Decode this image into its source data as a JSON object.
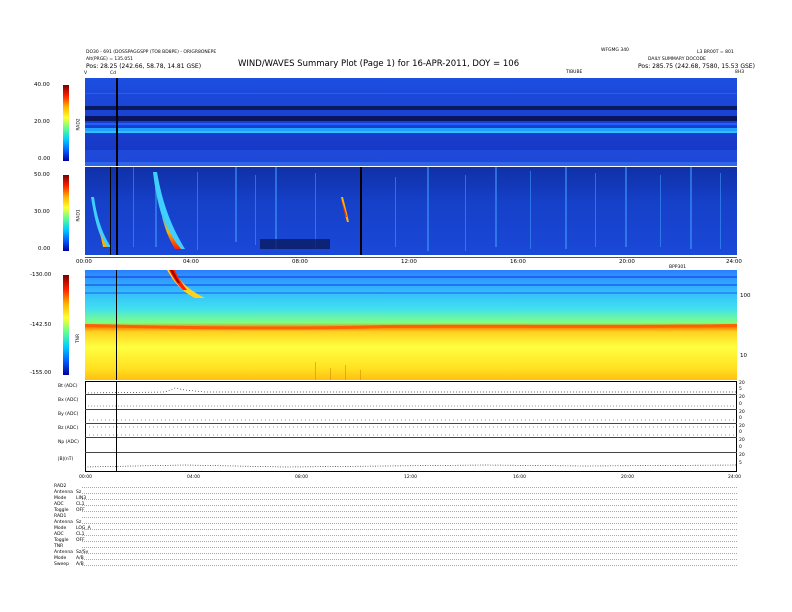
{
  "header": {
    "title": "WIND/WAVES Summary Plot (Page 1) for 16-APR-2011, DOY = 106",
    "top_left_line1": "DO30 - 691 (DOSSPAGGSPP (TO8 BD8PE) - ORIGR8ONEPE",
    "top_left_line2": "Alt(PRGE) = 135.051",
    "top_left_pos": "Pos:  28.25 (242.66, 58.78, 14.81 GSE)",
    "top_right_a": "WFGMG 340",
    "top_right_b": "L3 BR00T = 801",
    "top_right_c": "DAILY SUMMARY DOCODE",
    "top_right_pos": "Pos:  285.75 (242.68, 7580, 15.53 GSE)",
    "top_right_label": "TIBUBE",
    "top_far_right": "8H3"
  },
  "markers": {
    "start": "V",
    "cursor": "Cd"
  },
  "panels": {
    "rad2": {
      "label": "RAD2",
      "ticks": [
        "40.00",
        "20.00",
        "0.00"
      ]
    },
    "rad1": {
      "label": "RAD1",
      "ticks": [
        "50.00",
        "30.00",
        "0.00"
      ]
    },
    "tnr": {
      "label": "TNR",
      "ticks": [
        "-130.00",
        "-142.50",
        "-155.00"
      ],
      "right_ticks": [
        "100",
        "10"
      ],
      "right_tag": "BPP301"
    }
  },
  "time_axis": [
    "00:00",
    "04:00",
    "08:00",
    "12:00",
    "16:00",
    "20:00",
    "24:00"
  ],
  "bottom_axis": [
    "00:00",
    "04:00",
    "08:00",
    "12:00",
    "16:00",
    "20:00",
    "24:00"
  ],
  "traces": [
    {
      "label": "Bt (ADC)",
      "right": [
        "20",
        "5",
        "0"
      ]
    },
    {
      "label": "Bx (ADC)",
      "right": [
        "20",
        "5",
        "0"
      ]
    },
    {
      "label": "By (ADC)",
      "right": [
        "20",
        "5",
        "0"
      ]
    },
    {
      "label": "Bz (ADC)",
      "right": [
        "20",
        "5",
        "0"
      ]
    },
    {
      "label": "Np (ADC)",
      "right": [
        "20",
        "5",
        "0"
      ]
    },
    {
      "label": "|B|(nT)",
      "right": [
        "20",
        "5",
        "0"
      ]
    }
  ],
  "footer": {
    "rad2": {
      "name": "RAD2",
      "rows": [
        [
          "Antenna",
          "Sz"
        ],
        [
          "Mode",
          "LIN3"
        ],
        [
          "ADC",
          "CL1"
        ],
        [
          "Toggle",
          "OFF"
        ]
      ]
    },
    "rad1": {
      "name": "RAD1",
      "rows": [
        [
          "Antenna",
          "Sz"
        ],
        [
          "Mode",
          "LOG_A"
        ],
        [
          "ADC",
          "CL1"
        ],
        [
          "Toggle",
          "OFF"
        ]
      ]
    },
    "tnr": {
      "name": "TNR",
      "rows": [
        [
          "Antenna",
          "Sz/Sy"
        ],
        [
          "Mode",
          "A/B"
        ],
        [
          "Sweep",
          "A/B"
        ]
      ]
    }
  },
  "chart_data": [
    {
      "type": "heatmap",
      "title": "WIND/WAVES Summary Plot (Page 1) for 16-APR-2011, DOY = 106",
      "panel": "RAD2",
      "ylabel": "RAD2",
      "ylim": [
        0,
        40
      ],
      "colorbar_ticks": [
        40,
        20,
        0
      ],
      "x": [
        "00:00",
        "24:00"
      ]
    },
    {
      "type": "heatmap",
      "panel": "RAD1",
      "ylabel": "RAD1",
      "ylim": [
        0,
        50
      ],
      "colorbar_ticks": [
        50,
        30,
        0
      ],
      "x": [
        "00:00",
        "24:00"
      ]
    },
    {
      "type": "heatmap",
      "panel": "TNR",
      "ylabel": "TNR",
      "colorbar_ticks": [
        -130,
        -142.5,
        -155
      ],
      "right_ticks": [
        100,
        10
      ],
      "x": [
        "00:00",
        "04:00",
        "08:00",
        "12:00",
        "16:00",
        "20:00",
        "24:00"
      ]
    }
  ]
}
